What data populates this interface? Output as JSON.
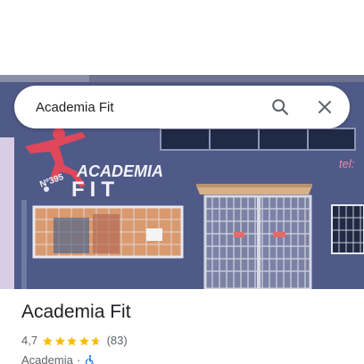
{
  "search": {
    "query": "Academia Fit"
  },
  "hero": {
    "facade_sign": "ACADEMIA FIT",
    "street_number": "Nº 395",
    "phone_fragment": "tel:"
  },
  "place": {
    "title": "Academia Fit",
    "rating": "4,7",
    "rating_fraction": 0.94,
    "review_count": "(83)",
    "category": "Academia",
    "separator": "·",
    "accessibility_icon": "wheelchair-accessible-icon"
  },
  "colors": {
    "star": "#fbbc04",
    "star_empty": "#dadce0",
    "accessibility": "#1a73e8",
    "wall": "#4f5a88"
  }
}
